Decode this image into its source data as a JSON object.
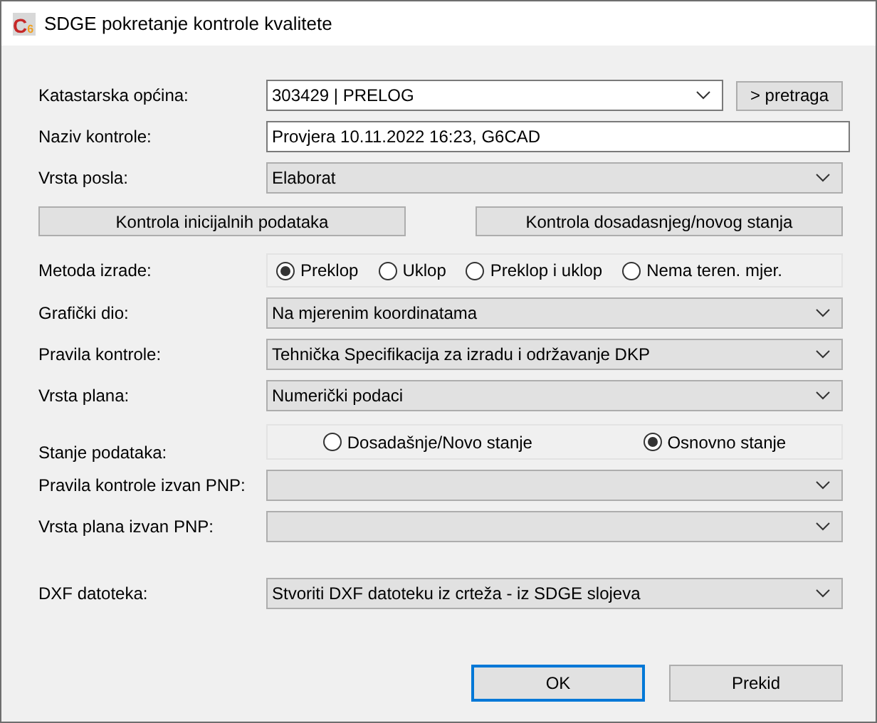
{
  "window": {
    "title": "SDGE pokretanje kontrole kvalitete",
    "icon": {
      "letter": "C",
      "subscript": "6"
    }
  },
  "rows": [
    {
      "kind": "combo_editable",
      "label": "Katastarska općina:",
      "value": "303429 | PRELOG",
      "button": "> pretraga"
    },
    {
      "kind": "text",
      "label": "Naziv kontrole:",
      "value": "Provjera 10.11.2022 16:23, G6CAD"
    },
    {
      "kind": "combo",
      "label": "Vrsta posla:",
      "value": "Elaborat"
    },
    {
      "kind": "buttons",
      "buttons": [
        "Kontrola inicijalnih podataka",
        "Kontrola dosadasnjeg/novog stanja"
      ]
    },
    {
      "kind": "radio",
      "label": "Metoda izrade:",
      "options": [
        {
          "label": "Preklop",
          "selected": true
        },
        {
          "label": "Uklop",
          "selected": false
        },
        {
          "label": "Preklop i uklop",
          "selected": false
        },
        {
          "label": "Nema teren. mjer.",
          "selected": false
        }
      ]
    },
    {
      "kind": "combo",
      "label": "Grafički dio:",
      "value": "Na mjerenim koordinatama"
    },
    {
      "kind": "combo",
      "label": "Pravila kontrole:",
      "value": "Tehnička Specifikacija za izradu i održavanje DKP"
    },
    {
      "kind": "combo",
      "label": "Vrsta plana:",
      "value": "Numerički podaci"
    },
    {
      "kind": "radio_wide",
      "label": "Stanje podataka:",
      "options": [
        {
          "label": "Dosadašnje/Novo stanje",
          "selected": false
        },
        {
          "label": "Osnovno stanje",
          "selected": true
        }
      ]
    },
    {
      "kind": "combo",
      "label": "Pravila kontrole izvan PNP:"
    },
    {
      "kind": "combo",
      "label": "Vrsta plana izvan PNP:"
    },
    {
      "kind": "combo",
      "label": "DXF datoteka:",
      "value": "Stvoriti DXF datoteku iz crteža - iz SDGE slojeva"
    }
  ],
  "footer": [
    {
      "label": "OK",
      "default": true
    },
    {
      "label": "Prekid",
      "default": false
    }
  ]
}
